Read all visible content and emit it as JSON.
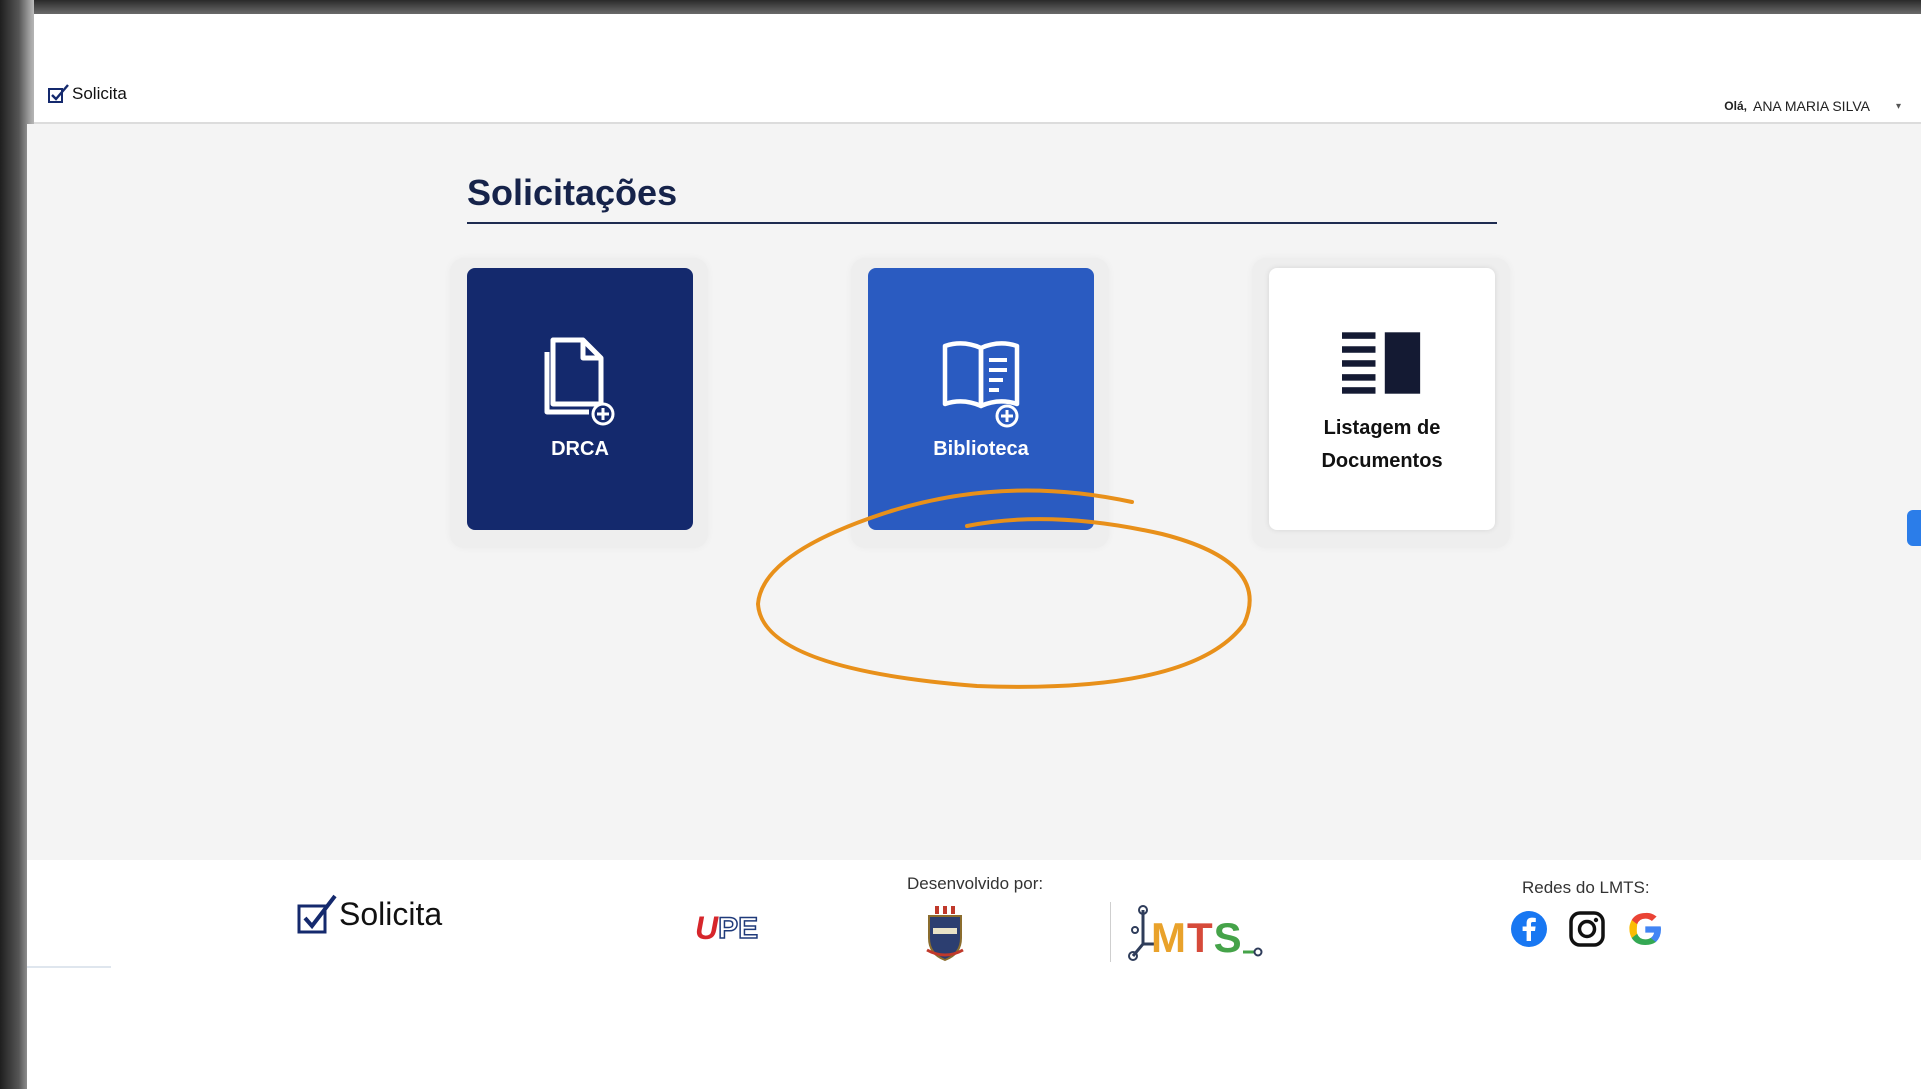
{
  "navbar": {
    "brand_label": "Solicita",
    "greeting_prefix": "Olá,",
    "user_name": "ANA MARIA SILVA",
    "dropdown_caret": "▾"
  },
  "main": {
    "section_title": "Solicitações",
    "cards": [
      {
        "label": "DRCA",
        "icon": "document-add-icon",
        "color": "#14296d"
      },
      {
        "label": "Biblioteca",
        "icon": "book-add-icon",
        "color": "#2a5bc1"
      },
      {
        "label_line1": "Listagem de",
        "label_line2": "Documentos",
        "icon": "document-list-icon",
        "color": "#ffffff"
      }
    ],
    "annotation_color": "#e8901a"
  },
  "footer": {
    "brand_label": "Solicita",
    "developed_by": "Desenvolvido por:",
    "upe_u": "U",
    "upe_pe": "PE",
    "lmts_l": "L",
    "lmts_m": "M",
    "lmts_t": "T",
    "lmts_s": "S",
    "social_title": "Redes do LMTS:",
    "social_icons": [
      "facebook-icon",
      "instagram-icon",
      "google-icon"
    ]
  }
}
